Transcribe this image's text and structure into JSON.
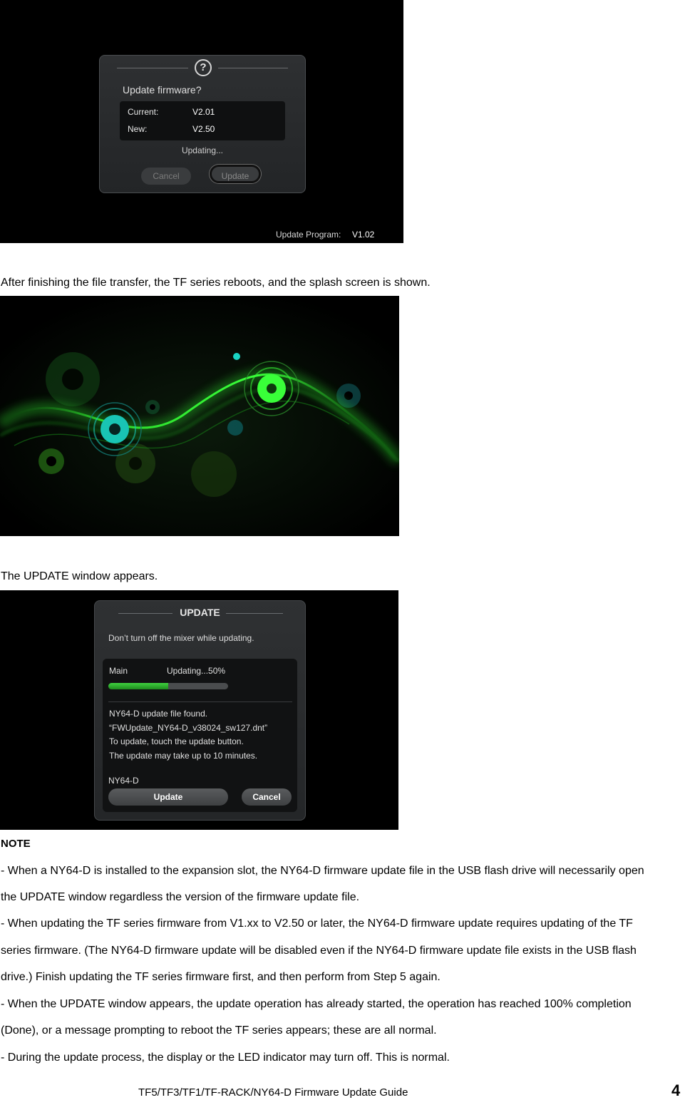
{
  "firmware_dialog": {
    "title": "Update firmware?",
    "current_label": "Current:",
    "current_value": "V2.01",
    "new_label": "New:",
    "new_value": "V2.50",
    "status": "Updating...",
    "cancel_label": "Cancel",
    "update_label": "Update",
    "program_label": "Update Program:",
    "program_version": "V1.02"
  },
  "caption_reboot": "After finishing the file transfer, the TF series reboots, and the splash screen is shown.",
  "caption_update_window": "The UPDATE window appears.",
  "update_window": {
    "title": "UPDATE",
    "warning": "Don’t turn off the mixer while updating.",
    "main_label": "Main",
    "main_status": "Updating...50%",
    "progress_fraction": 0.5,
    "messages": [
      "NY64-D update file found.",
      "“FWUpdate_NY64-D_v38024_sw127.dnt”",
      "To update, touch the update button.",
      "The update may take up to 10 minutes."
    ],
    "device_label": "NY64-D",
    "update_label": "Update",
    "cancel_label": "Cancel"
  },
  "note": {
    "heading": "NOTE",
    "lines": [
      "- When a NY64-D is installed to the expansion slot, the NY64-D firmware update file in the USB flash drive will necessarily open",
      "the UPDATE window regardless the version of the firmware update file.",
      "- When updating the TF series firmware from V1.xx to V2.50 or later, the NY64-D firmware update requires updating of the TF",
      "series firmware. (The NY64-D firmware update will be disabled even if the NY64-D firmware update file exists in the USB flash",
      "drive.) Finish updating the TF series firmware first, and then perform from Step 5 again.",
      "- When the UPDATE window appears, the update operation has already started, the operation has reached 100% completion",
      "(Done), or a message prompting to reboot the TF series appears; these are all normal.",
      "- During the update process, the display or the LED indicator may turn off. This is normal."
    ]
  },
  "footer": {
    "title": "TF5/TF3/TF1/TF-RACK/NY64-D Firmware Update Guide",
    "page": "4"
  },
  "colors": {
    "progress_green": "#3fd23f",
    "splash_green": "#39ff39",
    "splash_teal": "#19c4b4"
  }
}
